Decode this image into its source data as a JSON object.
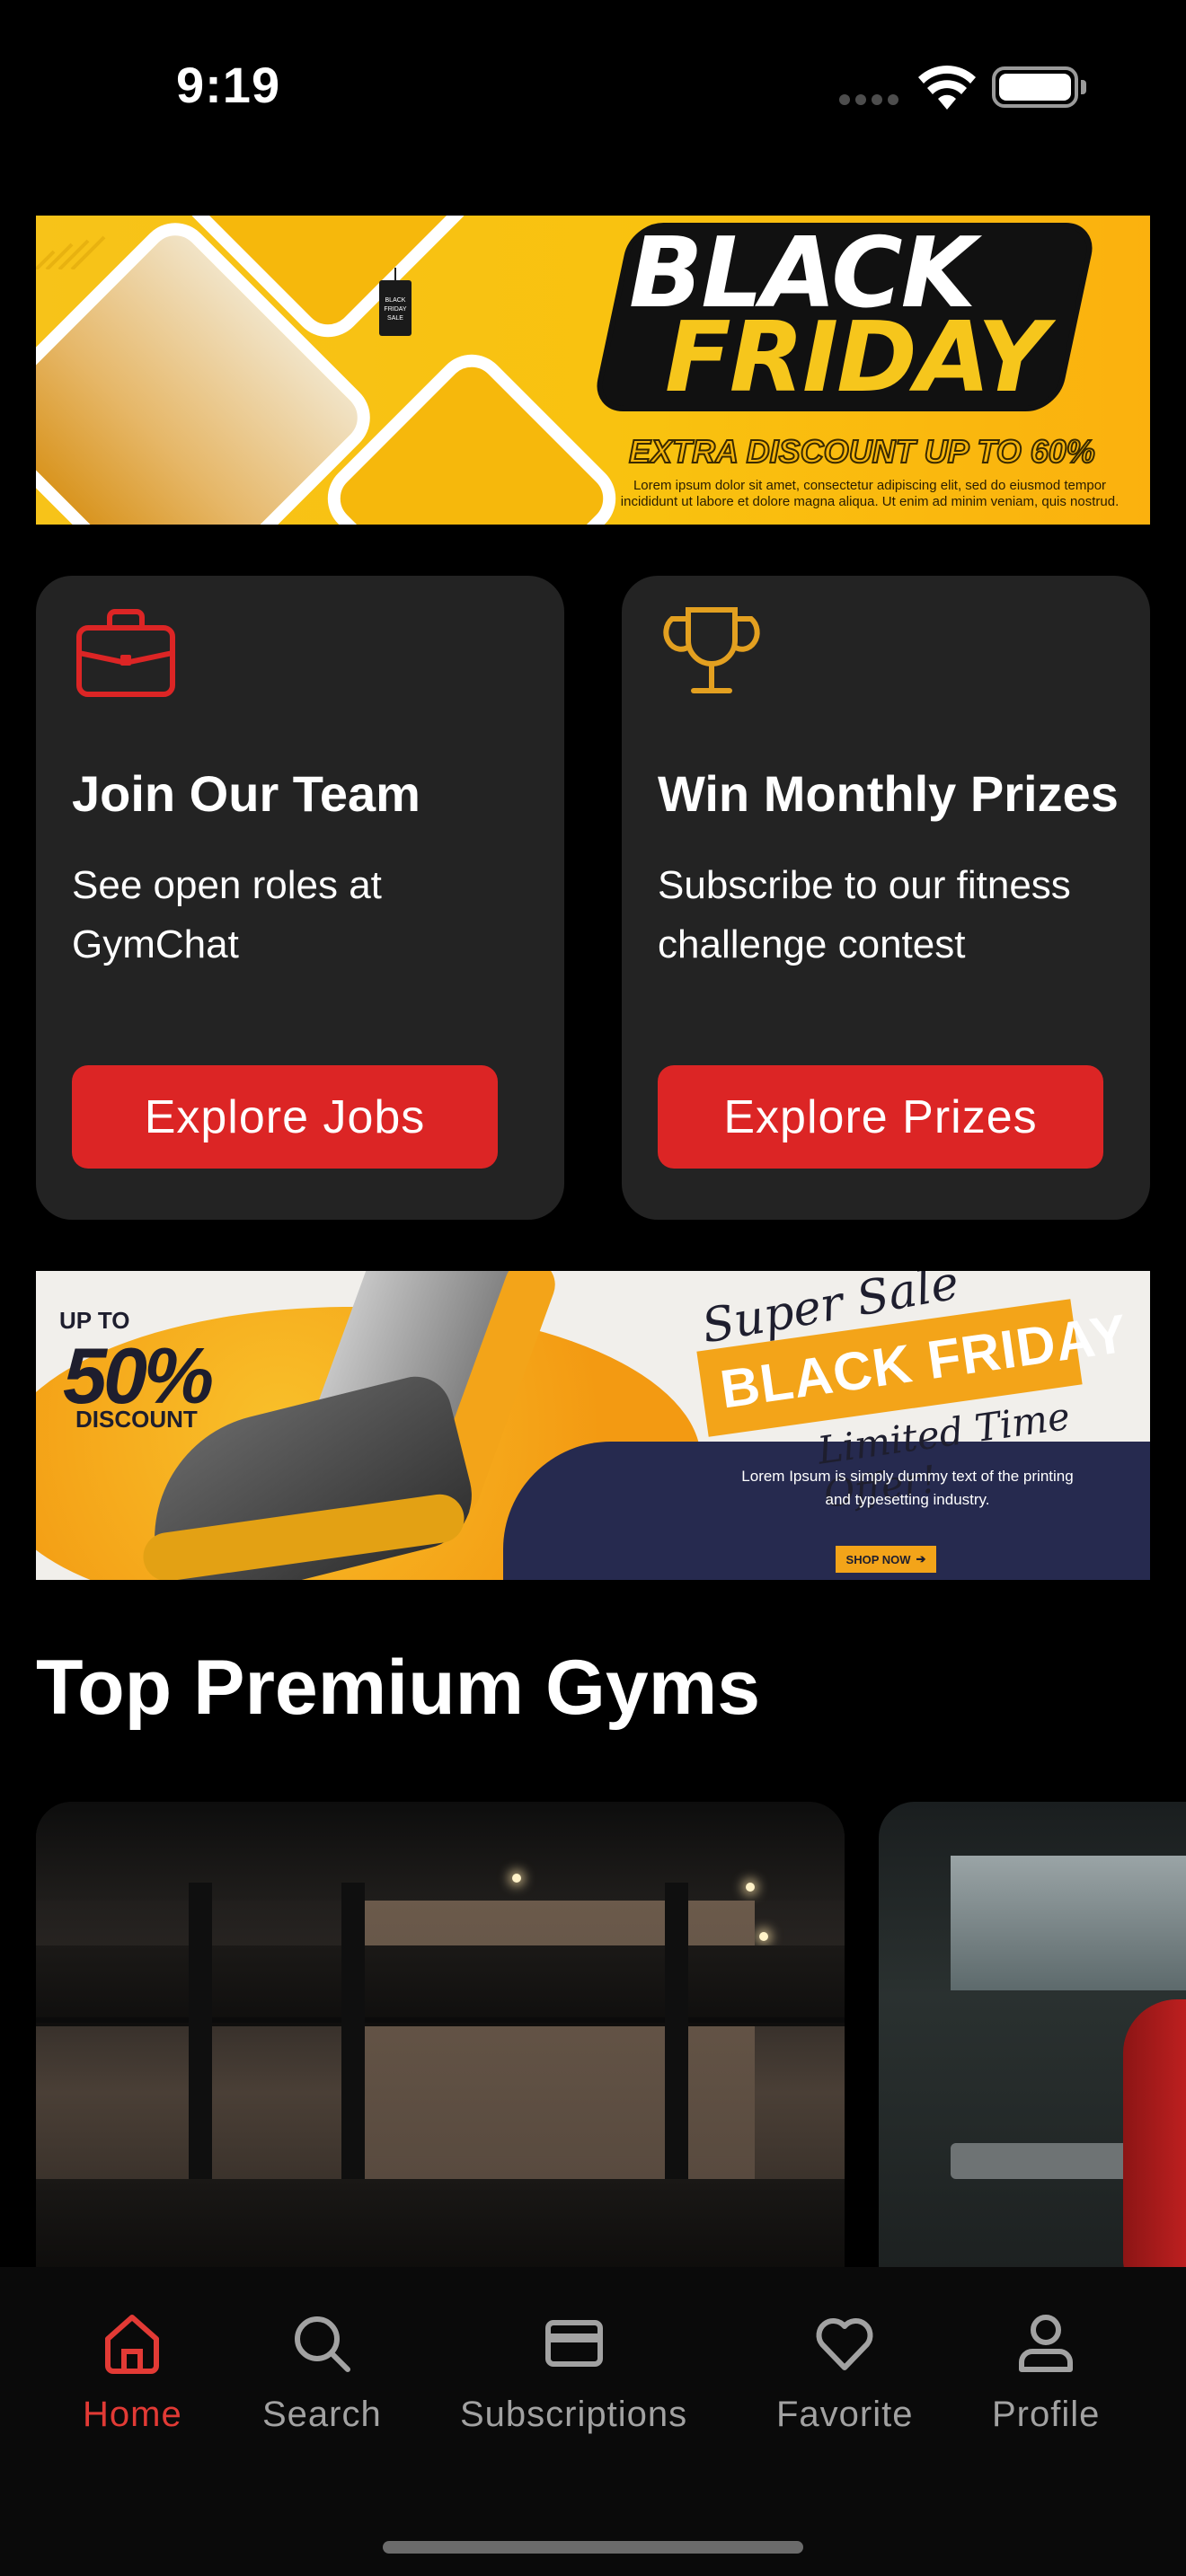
{
  "status": {
    "time": "9:19"
  },
  "promo_banner_1": {
    "headline_1": "BLACK",
    "headline_2": "FRIDAY",
    "discount": "EXTRA DISCOUNT UP TO 60%",
    "body": "Lorem ipsum dolor sit amet, consectetur adipiscing elit, sed do eiusmod tempor incididunt ut labore et dolore magna aliqua. Ut enim ad minim veniam, quis nostrud.",
    "tag": "BLACK FRIDAY SALE"
  },
  "cards": [
    {
      "icon": "briefcase-icon",
      "title": "Join Our Team",
      "description": "See open roles at GymChat",
      "button": "Explore Jobs"
    },
    {
      "icon": "trophy-icon",
      "title": "Win Monthly Prizes",
      "description": "Subscribe to our fitness challenge contest",
      "button": "Explore Prizes"
    }
  ],
  "promo_banner_2": {
    "up_to": "UP TO",
    "percent": "50%",
    "discount": "DISCOUNT",
    "super_sale": "Super Sale",
    "headline": "BLACK FRIDAY",
    "limited": "Limited Time Offer!",
    "body": "Lorem Ipsum is simply dummy text of the printing and typesetting industry.",
    "cta": "SHOP NOW"
  },
  "section": {
    "title": "Top Premium Gyms"
  },
  "tabbar": {
    "items": [
      {
        "label": "Home",
        "icon": "home-icon",
        "active": true
      },
      {
        "label": "Search",
        "icon": "search-icon",
        "active": false
      },
      {
        "label": "Subscriptions",
        "icon": "card-icon",
        "active": false
      },
      {
        "label": "Favorite",
        "icon": "heart-icon",
        "active": false
      },
      {
        "label": "Profile",
        "icon": "person-icon",
        "active": false
      }
    ]
  },
  "colors": {
    "accent": "#dc2525",
    "active_tab": "#e23a35",
    "trophy": "#e3a020",
    "card_bg": "#232323"
  }
}
